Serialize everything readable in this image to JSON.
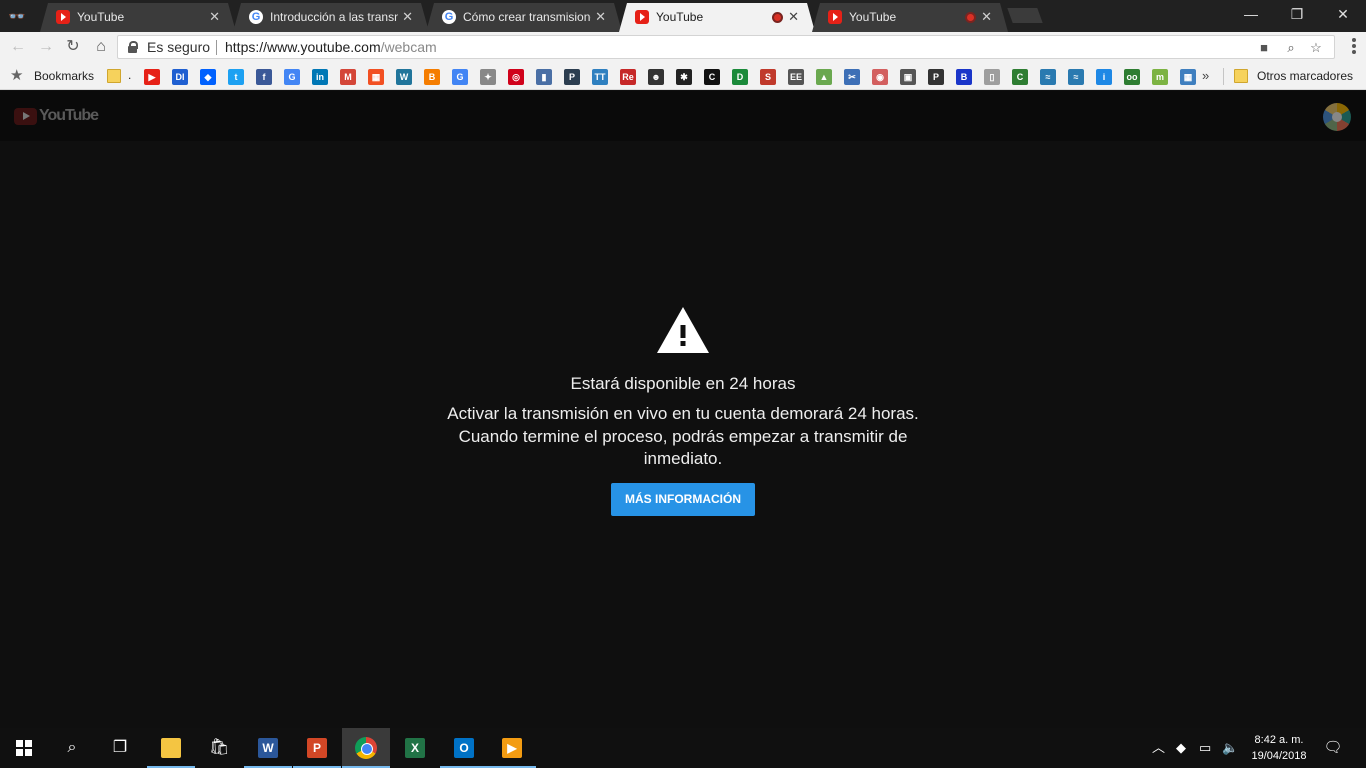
{
  "tabs": [
    {
      "title": "YouTube",
      "favicon": "youtube-icon",
      "active": false,
      "recording": false
    },
    {
      "title": "Introducción a las transmisiones",
      "favicon": "google-icon",
      "active": false,
      "recording": false
    },
    {
      "title": "Cómo crear transmisiones en vivo",
      "favicon": "google-icon",
      "active": false,
      "recording": false
    },
    {
      "title": "YouTube",
      "favicon": "youtube-icon",
      "active": true,
      "recording": true
    },
    {
      "title": "YouTube",
      "favicon": "youtube-icon",
      "active": false,
      "recording": true
    }
  ],
  "window_controls": {
    "minimize": "—",
    "restore": "❐",
    "close": "✕"
  },
  "address_bar": {
    "security_label": "Es seguro",
    "url_host": "https://www.youtube.com",
    "url_path": "/webcam"
  },
  "bookmarks_bar": {
    "label": "Bookmarks",
    "folder_dot": ".",
    "overflow": "»",
    "other_label": "Otros marcadores",
    "icons": [
      {
        "name": "youtube",
        "color": "#e62117",
        "glyph": "▶"
      },
      {
        "name": "di",
        "color": "#1f5fd1",
        "glyph": "DI"
      },
      {
        "name": "dropbox",
        "color": "#0061fe",
        "glyph": "◆"
      },
      {
        "name": "twitter",
        "color": "#1da1f2",
        "glyph": "t"
      },
      {
        "name": "facebook",
        "color": "#3b5998",
        "glyph": "f"
      },
      {
        "name": "google",
        "color": "#4285f4",
        "glyph": "G"
      },
      {
        "name": "linkedin",
        "color": "#0077b5",
        "glyph": "in"
      },
      {
        "name": "gmail",
        "color": "#d44638",
        "glyph": "M"
      },
      {
        "name": "microsoft",
        "color": "#f25022",
        "glyph": "▦"
      },
      {
        "name": "wordpress",
        "color": "#21759b",
        "glyph": "W"
      },
      {
        "name": "blogger",
        "color": "#f57d00",
        "glyph": "B"
      },
      {
        "name": "google-2",
        "color": "#4285f4",
        "glyph": "G"
      },
      {
        "name": "compass",
        "color": "#888888",
        "glyph": "✦"
      },
      {
        "name": "target",
        "color": "#d0021b",
        "glyph": "◎"
      },
      {
        "name": "bars",
        "color": "#4a6fa5",
        "glyph": "▮"
      },
      {
        "name": "p-site",
        "color": "#2c3e50",
        "glyph": "P"
      },
      {
        "name": "tt",
        "color": "#2f80c0",
        "glyph": "TT"
      },
      {
        "name": "re",
        "color": "#c62828",
        "glyph": "Re"
      },
      {
        "name": "face",
        "color": "#333333",
        "glyph": "☻"
      },
      {
        "name": "cat",
        "color": "#222222",
        "glyph": "✱"
      },
      {
        "name": "c-site",
        "color": "#111111",
        "glyph": "C"
      },
      {
        "name": "d-site",
        "color": "#1b8a3a",
        "glyph": "D"
      },
      {
        "name": "s-site",
        "color": "#c0392b",
        "glyph": "S"
      },
      {
        "name": "ee",
        "color": "#555555",
        "glyph": "EE"
      },
      {
        "name": "landscape",
        "color": "#6aa84f",
        "glyph": "▲"
      },
      {
        "name": "scissors",
        "color": "#3d6fb6",
        "glyph": "✂"
      },
      {
        "name": "ring",
        "color": "#d35f5f",
        "glyph": "◉"
      },
      {
        "name": "bin",
        "color": "#555555",
        "glyph": "▣"
      },
      {
        "name": "p-small",
        "color": "#333333",
        "glyph": "P"
      },
      {
        "name": "b-blue",
        "color": "#1a35c9",
        "glyph": "B"
      },
      {
        "name": "page",
        "color": "#9e9e9e",
        "glyph": "▯"
      },
      {
        "name": "c-green",
        "color": "#2e7d32",
        "glyph": "C"
      },
      {
        "name": "wave-1",
        "color": "#2a7ab0",
        "glyph": "≈"
      },
      {
        "name": "wave-2",
        "color": "#2a7ab0",
        "glyph": "≈"
      },
      {
        "name": "info",
        "color": "#1e88e5",
        "glyph": "i"
      },
      {
        "name": "oo",
        "color": "#2e7d32",
        "glyph": "oo"
      },
      {
        "name": "m-green",
        "color": "#7cb342",
        "glyph": "m"
      },
      {
        "name": "calendar",
        "color": "#3f7fbf",
        "glyph": "▦"
      }
    ]
  },
  "youtube": {
    "logo_text": "YouTube",
    "message_title": "Estará disponible en 24 horas",
    "message_body": "Activar la transmisión en vivo en tu cuenta demorará 24 horas. Cuando termine el proceso, podrás empezar a transmitir de inmediato.",
    "button_label": "MÁS INFORMACIÓN",
    "accent_color": "#2793e6"
  },
  "taskbar": {
    "apps": [
      "start",
      "search",
      "task-view",
      "file-explorer",
      "store",
      "word",
      "powerpoint",
      "chrome",
      "excel",
      "outlook",
      "media-player"
    ],
    "active_app": "chrome",
    "clock_time": "8:42 a. m.",
    "clock_date": "19/04/2018"
  }
}
